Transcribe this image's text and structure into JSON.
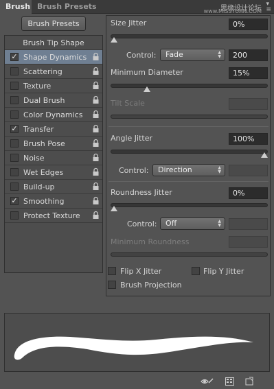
{
  "tabs": [
    "Brush",
    "Brush Presets"
  ],
  "watermark": [
    "思缘设计论坛",
    "www.MISSYUAN.COM"
  ],
  "presets_button": "Brush Presets",
  "sidebar": {
    "header": "Brush Tip Shape",
    "items": [
      {
        "label": "Shape Dynamics",
        "checked": true,
        "selected": true
      },
      {
        "label": "Scattering",
        "checked": false
      },
      {
        "label": "Texture",
        "checked": false
      },
      {
        "label": "Dual Brush",
        "checked": false
      },
      {
        "label": "Color Dynamics",
        "checked": false
      },
      {
        "label": "Transfer",
        "checked": true
      },
      {
        "label": "Brush Pose",
        "checked": false
      },
      {
        "label": "Noise",
        "checked": false
      },
      {
        "label": "Wet Edges",
        "checked": false
      },
      {
        "label": "Build-up",
        "checked": false
      },
      {
        "label": "Smoothing",
        "checked": true
      },
      {
        "label": "Protect Texture",
        "checked": false
      }
    ]
  },
  "size_jitter": {
    "label": "Size Jitter",
    "value": "0%",
    "level": 0
  },
  "control1": {
    "label": "Control:",
    "selected": "Fade",
    "value": "200"
  },
  "min_diameter": {
    "label": "Minimum Diameter",
    "value": "15%",
    "level": 0.15
  },
  "tilt_scale": {
    "label": "Tilt Scale",
    "value": ""
  },
  "angle_jitter": {
    "label": "Angle Jitter",
    "value": "100%",
    "level": 1
  },
  "control2": {
    "label": "Control:",
    "selected": "Direction"
  },
  "roundness_jitter": {
    "label": "Roundness Jitter",
    "value": "0%",
    "level": 0
  },
  "control3": {
    "label": "Control:",
    "selected": "Off"
  },
  "min_roundness": {
    "label": "Minimum Roundness",
    "value": ""
  },
  "flip_x": {
    "label": "Flip X Jitter",
    "checked": false
  },
  "flip_y": {
    "label": "Flip Y Jitter",
    "checked": false
  },
  "brush_projection": {
    "label": "Brush Projection",
    "checked": false
  },
  "bottom_icons": [
    "toggle-live-tip-icon",
    "grid-icon",
    "new-brush-icon"
  ]
}
